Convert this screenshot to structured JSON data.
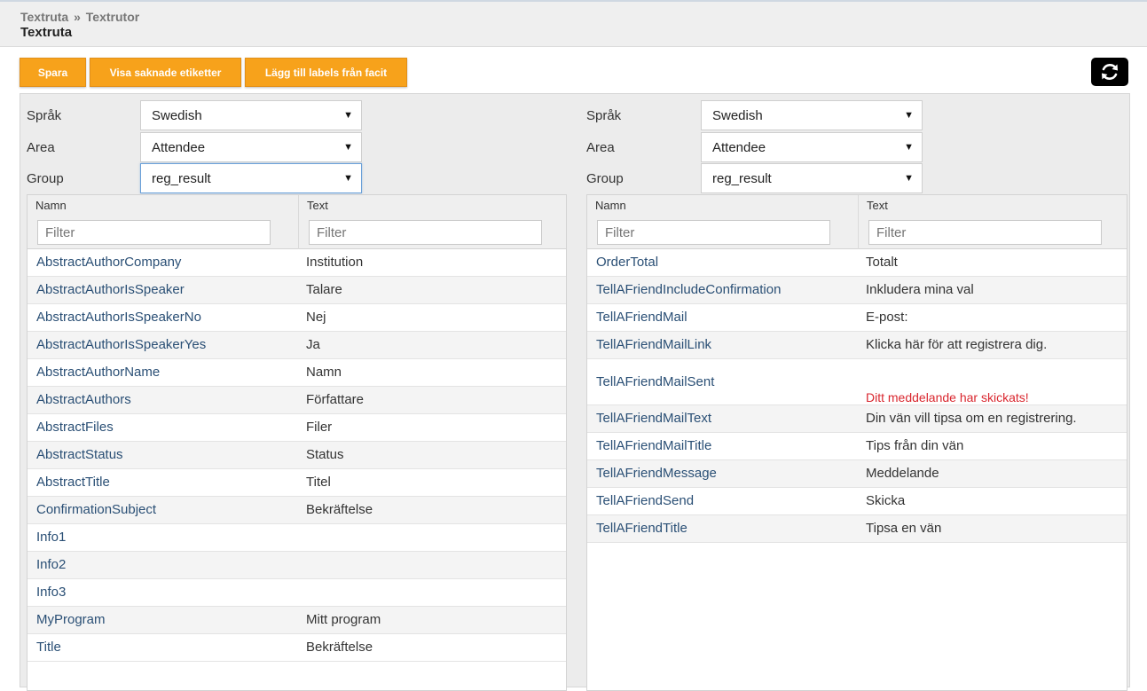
{
  "breadcrumb": {
    "parent": "Textruta",
    "separator": "»",
    "current": "Textrutor"
  },
  "page_title": "Textruta",
  "toolbar": {
    "save_label": "Spara",
    "show_missing_label": "Visa saknade etiketter",
    "add_labels_label": "Lägg till labels från facit",
    "refresh_icon": "refresh-icon"
  },
  "left_panel": {
    "language_label": "Språk",
    "language_value": "Swedish",
    "area_label": "Area",
    "area_value": "Attendee",
    "group_label": "Group",
    "group_value": "reg_result",
    "col_name": "Namn",
    "col_text": "Text",
    "filter_placeholder": "Filter",
    "rows": [
      {
        "name": "AbstractAuthorCompany",
        "text": "Institution"
      },
      {
        "name": "AbstractAuthorIsSpeaker",
        "text": "Talare"
      },
      {
        "name": "AbstractAuthorIsSpeakerNo",
        "text": "Nej"
      },
      {
        "name": "AbstractAuthorIsSpeakerYes",
        "text": "Ja"
      },
      {
        "name": "AbstractAuthorName",
        "text": "Namn"
      },
      {
        "name": "AbstractAuthors",
        "text": "Författare"
      },
      {
        "name": "AbstractFiles",
        "text": "Filer"
      },
      {
        "name": "AbstractStatus",
        "text": "Status"
      },
      {
        "name": "AbstractTitle",
        "text": "Titel"
      },
      {
        "name": "ConfirmationSubject",
        "text": "Bekräftelse"
      },
      {
        "name": "Info1",
        "text": ""
      },
      {
        "name": "Info2",
        "text": ""
      },
      {
        "name": "Info3",
        "text": ""
      },
      {
        "name": "MyProgram",
        "text": "Mitt program"
      },
      {
        "name": "Title",
        "text": "Bekräftelse"
      }
    ]
  },
  "right_panel": {
    "language_label": "Språk",
    "language_value": "Swedish",
    "area_label": "Area",
    "area_value": "Attendee",
    "group_label": "Group",
    "group_value": "reg_result",
    "col_name": "Namn",
    "col_text": "Text",
    "filter_placeholder": "Filter",
    "rows": [
      {
        "name": "OrderTotal",
        "text": "Totalt"
      },
      {
        "name": "TellAFriendIncludeConfirmation",
        "text": "Inkludera mina val"
      },
      {
        "name": "TellAFriendMail",
        "text": "E-post:"
      },
      {
        "name": "TellAFriendMailLink",
        "text": "Klicka här för att registrera dig."
      },
      {
        "name": "TellAFriendMailSent",
        "text": "Ditt meddelande har skickats!"
      },
      {
        "name": "TellAFriendMailText",
        "text": "Din vän vill tipsa om en registrering."
      },
      {
        "name": "TellAFriendMailTitle",
        "text": "Tips från din vän"
      },
      {
        "name": "TellAFriendMessage",
        "text": "Meddelande"
      },
      {
        "name": "TellAFriendSend",
        "text": "Skicka"
      },
      {
        "name": "TellAFriendTitle",
        "text": "Tipsa en vän"
      }
    ]
  },
  "colors": {
    "accent": "#f7a21b",
    "name_link": "#2a4f75",
    "error_text": "#d9262e"
  }
}
